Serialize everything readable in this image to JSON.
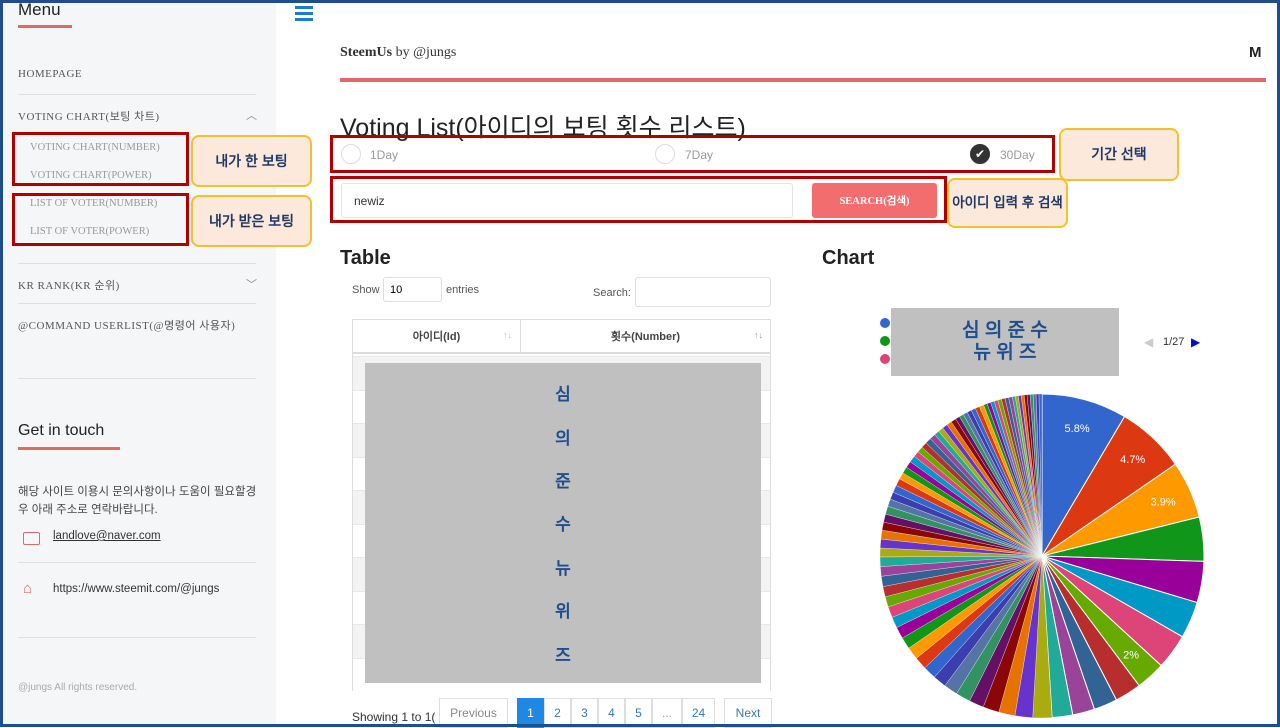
{
  "sidebar": {
    "menu_title": "Menu",
    "items": [
      {
        "label": "HOMEPAGE"
      },
      {
        "label": "VOTING CHART(보팅 차트)",
        "sub": [
          "VOTING CHART(NUMBER)",
          "VOTING CHART(POWER)",
          "LIST OF VOTER(NUMBER)",
          "LIST OF VOTER(POWER)"
        ]
      },
      {
        "label": "KR RANK(KR 순위)"
      },
      {
        "label": "@COMMAND USERLIST(@명령어 사용자)"
      }
    ],
    "contact_title": "Get in touch",
    "contact_text": "해당 사이트 이용시 문의사항이나 도움이 필요할경우 아래 주소로 연락바랍니다.",
    "email": "landlove@naver.com",
    "homepage": "https://www.steemit.com/@jungs",
    "footer": "@jungs All rights reserved."
  },
  "annotations": {
    "my_votes": "내가 한 보팅",
    "received_votes": "내가 받은 보팅",
    "period": "기간 선택",
    "search": "아이디 입력 후 검색",
    "redacted_legend": "심 의 준 수\n뉴 위 즈",
    "redacted_table": [
      "심",
      "의",
      "준",
      "수",
      "뉴",
      "위",
      "즈"
    ]
  },
  "header": {
    "brand": "SteemUs",
    "by": "by @jungs",
    "logo": "M"
  },
  "page_title": "Voting List",
  "page_title_kr": "(아이디의 보팅 횟수 리스트)",
  "periods": [
    {
      "label": "1Day",
      "checked": false
    },
    {
      "label": "7Day",
      "checked": false
    },
    {
      "label": "30Day",
      "checked": true
    }
  ],
  "search": {
    "value": "newiz",
    "button": "SEARCH(검색)"
  },
  "table": {
    "title": "Table",
    "show": "Show",
    "entries_value": "10",
    "entries": "entries",
    "search_label": "Search:",
    "columns": [
      "아이디(Id)",
      "횟수(Number)"
    ],
    "showing": "Showing 1 to 1(",
    "pagination": [
      "Previous",
      "1",
      "2",
      "3",
      "4",
      "5",
      "...",
      "24",
      "Next"
    ],
    "active_page": "1"
  },
  "chart": {
    "title": "Chart",
    "legend_page": "1/27",
    "colors": {
      "accent": "#e06868",
      "primary": "#1f4e8c"
    }
  },
  "chart_data": {
    "type": "pie",
    "labels_shown": [
      "5.8%",
      "4.7%",
      "3.9%",
      "2%"
    ],
    "values": [
      5.8,
      4.7,
      3.9,
      3.0,
      2.8,
      2.5,
      2.4,
      2.0,
      1.8,
      1.6,
      1.5,
      1.4,
      1.3,
      1.2,
      1.1,
      1.1,
      1.0,
      1.0,
      0.95,
      0.9,
      0.9,
      0.85,
      0.85,
      0.8,
      0.8,
      0.75,
      0.75,
      0.7,
      0.7,
      0.7,
      0.65,
      0.65,
      0.6,
      0.6,
      0.6,
      0.55,
      0.55,
      0.55,
      0.5,
      0.5,
      0.5,
      0.5,
      0.45,
      0.45,
      0.45,
      0.45,
      0.4,
      0.4,
      0.4,
      0.4,
      0.4,
      0.35,
      0.35,
      0.35,
      0.35,
      0.35,
      0.3,
      0.3,
      0.3,
      0.3,
      0.3,
      0.3,
      0.3,
      0.25,
      0.25,
      0.25,
      0.25,
      0.25,
      0.25,
      0.25,
      0.25,
      0.2,
      0.2,
      0.2,
      0.2,
      0.2,
      0.2,
      0.2,
      0.2,
      0.2,
      0.2
    ]
  }
}
